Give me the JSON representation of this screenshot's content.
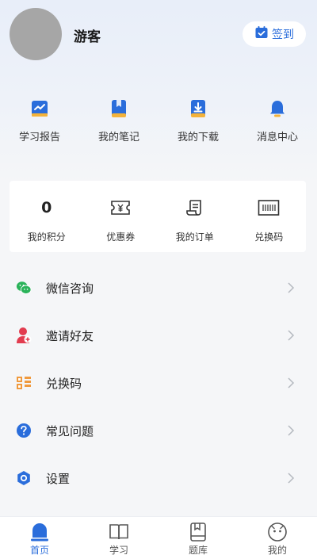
{
  "profile": {
    "username": "游客",
    "signin_label": "签到"
  },
  "quick_actions": [
    {
      "label": "学习报告",
      "icon": "chart-report-icon"
    },
    {
      "label": "我的笔记",
      "icon": "notebook-icon"
    },
    {
      "label": "我的下载",
      "icon": "download-icon"
    },
    {
      "label": "消息中心",
      "icon": "bell-icon"
    }
  ],
  "stats": [
    {
      "value": "0",
      "label": "我的积分"
    },
    {
      "label": "优惠券",
      "icon": "coupon-icon"
    },
    {
      "label": "我的订单",
      "icon": "order-scroll-icon"
    },
    {
      "label": "兑换码",
      "icon": "barcode-icon"
    }
  ],
  "menu": [
    {
      "label": "微信咨询",
      "icon": "wechat-icon"
    },
    {
      "label": "邀请好友",
      "icon": "invite-friend-icon"
    },
    {
      "label": "兑换码",
      "icon": "redeem-code-icon"
    },
    {
      "label": "常见问题",
      "icon": "question-icon"
    },
    {
      "label": "设置",
      "icon": "settings-icon"
    }
  ],
  "tabs": [
    {
      "label": "首页",
      "icon": "home-icon",
      "active": true
    },
    {
      "label": "学习",
      "icon": "book-icon",
      "active": false
    },
    {
      "label": "题库",
      "icon": "question-bank-icon",
      "active": false
    },
    {
      "label": "我的",
      "icon": "profile-face-icon",
      "active": false
    }
  ],
  "colors": {
    "accent": "#2a6ddb",
    "wechat": "#2bb35a",
    "invite": "#e23c4f",
    "redeem": "#f09a3e"
  }
}
